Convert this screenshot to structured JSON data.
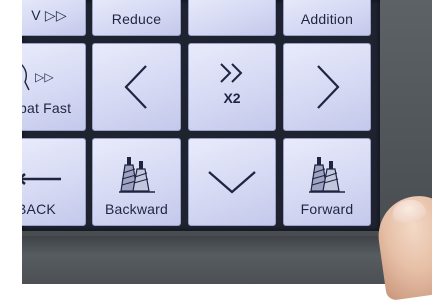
{
  "buttons": {
    "top_left_partial": "V ▷▷",
    "reduce": "Reduce",
    "addition": "Addition",
    "fast_partial": "pat Fast",
    "fast_partial_arrows": "▷▷",
    "speed": "X2",
    "back_partial": "BACK",
    "backward": "Backward",
    "forward": "Forward"
  },
  "icons": {
    "left": "chevron-left-icon",
    "right": "chevron-right-icon",
    "down": "chevron-down-icon",
    "double_right": "double-chevron-right-icon",
    "back_arrow": "arrow-left-icon",
    "spool_backward": "thread-spool-icon",
    "spool_forward": "thread-spool-icon"
  },
  "colors": {
    "button_face": "#d5d9f3",
    "button_border": "#9aa0c8",
    "label": "#1f2540",
    "screen_gap": "#1f2330",
    "bezel": "#55595d"
  }
}
